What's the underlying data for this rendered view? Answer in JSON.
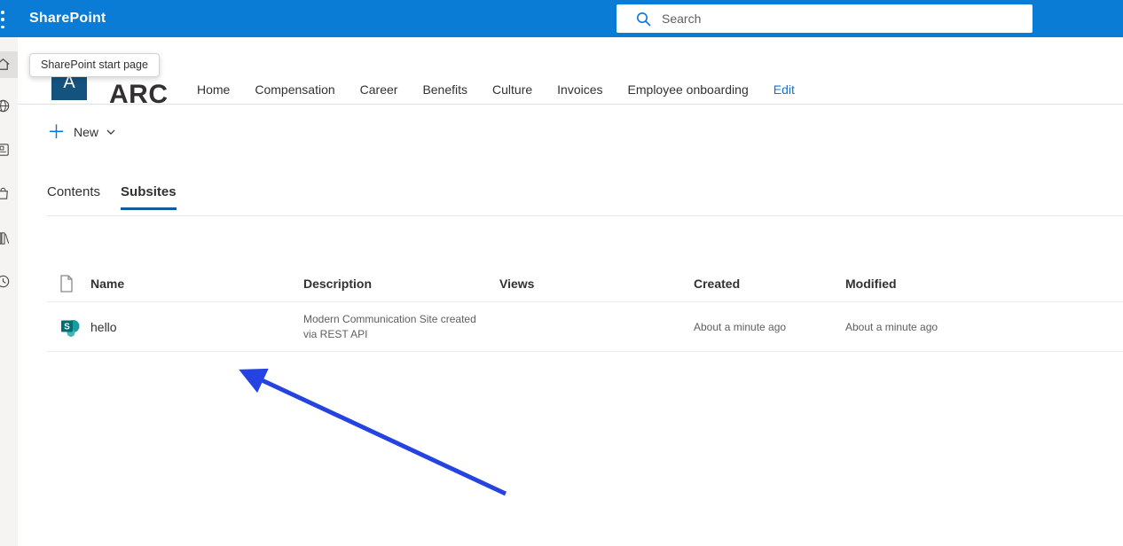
{
  "suite_bar": {
    "app_name": "SharePoint",
    "search": {
      "placeholder": "Search"
    }
  },
  "tooltip": {
    "text": "SharePoint start page"
  },
  "sidebar": {
    "items": [
      {
        "icon": "home-icon",
        "active": true
      },
      {
        "icon": "globe-icon",
        "active": false
      },
      {
        "icon": "news-icon",
        "active": false
      },
      {
        "icon": "shopping-bag-icon",
        "active": false
      },
      {
        "icon": "library-icon",
        "active": false
      },
      {
        "icon": "clock-icon",
        "active": false
      }
    ]
  },
  "site": {
    "logo_letter": "A",
    "title": "ARC",
    "nav": [
      {
        "label": "Home"
      },
      {
        "label": "Compensation"
      },
      {
        "label": "Career"
      },
      {
        "label": "Benefits"
      },
      {
        "label": "Culture"
      },
      {
        "label": "Invoices"
      },
      {
        "label": "Employee onboarding"
      },
      {
        "label": "Edit",
        "accent": true
      }
    ]
  },
  "command_bar": {
    "new_label": "New",
    "plus_icon": "plus-icon",
    "chevron_icon": "chevron-down-icon"
  },
  "tabs": [
    {
      "label": "Contents",
      "active": false
    },
    {
      "label": "Subsites",
      "active": true
    }
  ],
  "table": {
    "columns": [
      "Name",
      "Description",
      "Views",
      "Created",
      "Modified"
    ],
    "rows": [
      {
        "icon": "sharepoint-site-icon",
        "name": "hello",
        "description": "Modern Communication Site created via REST API",
        "views": "",
        "created": "About a minute ago",
        "modified": "About a minute ago"
      }
    ]
  },
  "annotation": {
    "shape": "arrow",
    "direction": "pointing-up-left"
  },
  "colors": {
    "suite_bar": "#0B7CD6",
    "accent_link": "#0B76D7",
    "logo_bg": "#14537E",
    "tab_underline": "#15599E",
    "arrow": "#2543E0",
    "sp_icon_square": "#036C70",
    "sp_icon_circle": "#1A9BA1",
    "text_primary": "#323130",
    "text_secondary": "#605e5c",
    "divider": "#edebe9"
  }
}
